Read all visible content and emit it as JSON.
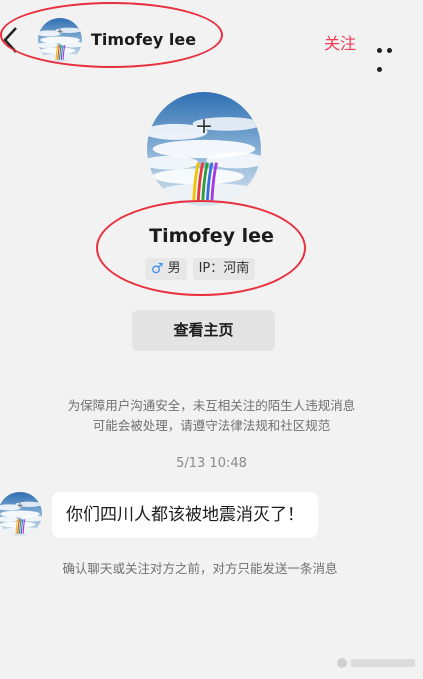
{
  "header": {
    "name": "Timofey lee",
    "follow_label": "关注",
    "back_icon": "chevron-left-icon",
    "more_icon": "more-dots-icon"
  },
  "profile": {
    "name": "Timofey lee",
    "gender_icon": "♂",
    "gender": "男",
    "ip_label": "IP：河南",
    "home_button": "查看主页"
  },
  "chat": {
    "notice_line1": "为保障用户沟通安全，未互相关注的陌生人违规消息",
    "notice_line2": "可能会被处理，请遵守法律法规和社区规范",
    "timestamp": "5/13 10:48",
    "message": "你们四川人都该被地震消灭了！",
    "limit_note": "确认聊天或关注对方之前，对方只能发送一条消息"
  },
  "colors": {
    "accent": "#ef3b55",
    "annotation": "#e8303f",
    "background": "#f2f2f2"
  }
}
